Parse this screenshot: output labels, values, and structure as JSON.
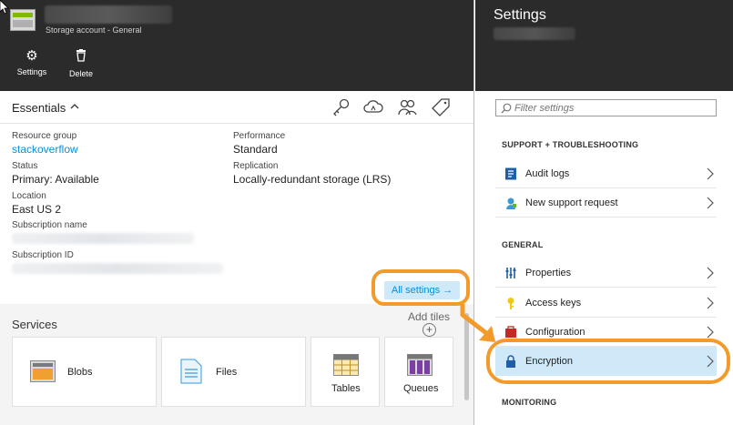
{
  "left_blade": {
    "subtitle": "Storage account - General",
    "commands": [
      {
        "label": "Settings",
        "icon": "gear-icon"
      },
      {
        "label": "Delete",
        "icon": "trash-icon"
      }
    ],
    "essentials": {
      "title": "Essentials",
      "fields": {
        "resource_group_label": "Resource group",
        "resource_group_value": "stackoverflow",
        "status_label": "Status",
        "status_value": "Primary: Available",
        "location_label": "Location",
        "location_value": "East US 2",
        "subscription_name_label": "Subscription name",
        "subscription_id_label": "Subscription ID",
        "performance_label": "Performance",
        "performance_value": "Standard",
        "replication_label": "Replication",
        "replication_value": "Locally-redundant storage (LRS)"
      },
      "all_settings_label": "All settings →"
    },
    "services": {
      "title": "Services",
      "add_tiles_label": "Add tiles",
      "tiles": [
        {
          "label": "Blobs",
          "icon": "blobs-icon"
        },
        {
          "label": "Files",
          "icon": "files-icon"
        },
        {
          "label": "Tables",
          "icon": "tables-icon"
        },
        {
          "label": "Queues",
          "icon": "queues-icon"
        }
      ]
    }
  },
  "settings_blade": {
    "title": "Settings",
    "filter_placeholder": "Filter settings",
    "sections": [
      {
        "heading": "SUPPORT + TROUBLESHOOTING",
        "items": [
          {
            "label": "Audit logs",
            "icon": "audit-logs-icon"
          },
          {
            "label": "New support request",
            "icon": "support-request-icon"
          }
        ]
      },
      {
        "heading": "GENERAL",
        "items": [
          {
            "label": "Properties",
            "icon": "properties-icon"
          },
          {
            "label": "Access keys",
            "icon": "key-icon"
          },
          {
            "label": "Configuration",
            "icon": "configuration-icon"
          },
          {
            "label": "Encryption",
            "icon": "lock-icon",
            "selected": true
          }
        ]
      },
      {
        "heading": "MONITORING",
        "items": []
      }
    ]
  },
  "colors": {
    "header_bg": "#2b2b2b",
    "link_blue": "#0b8ed8",
    "highlight_bg": "#cfe9f8",
    "callout_orange": "#f29b2a"
  }
}
